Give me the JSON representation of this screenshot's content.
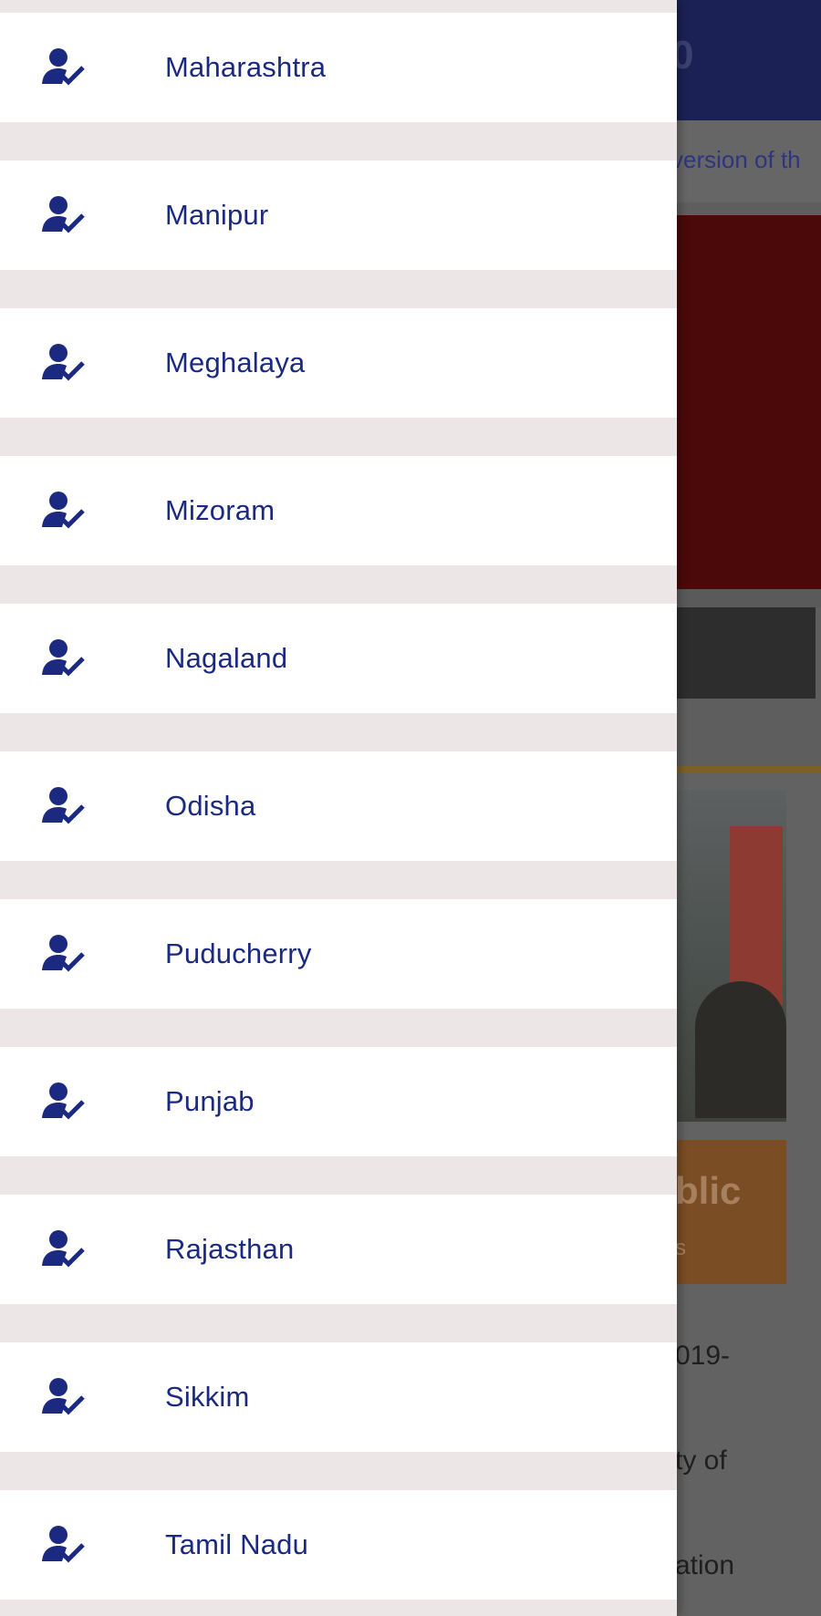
{
  "background": {
    "header_partial_text": "0",
    "marquee_partial": "version of th",
    "card_title_partial": "blic",
    "card_subtitle_partial": "s",
    "text_lines": [
      "019-",
      "ty of",
      "ation"
    ]
  },
  "drawer": {
    "icon": "person-check-icon",
    "colors": {
      "label": "#1b2a80",
      "icon": "#1b2a80",
      "item_bg": "#ffffff",
      "separator": "#ece7e6"
    },
    "items": [
      {
        "label": "Maharashtra"
      },
      {
        "label": "Manipur"
      },
      {
        "label": "Meghalaya"
      },
      {
        "label": "Mizoram"
      },
      {
        "label": "Nagaland"
      },
      {
        "label": "Odisha"
      },
      {
        "label": "Puducherry"
      },
      {
        "label": "Punjab"
      },
      {
        "label": "Rajasthan"
      },
      {
        "label": "Sikkim"
      },
      {
        "label": "Tamil Nadu"
      }
    ]
  }
}
